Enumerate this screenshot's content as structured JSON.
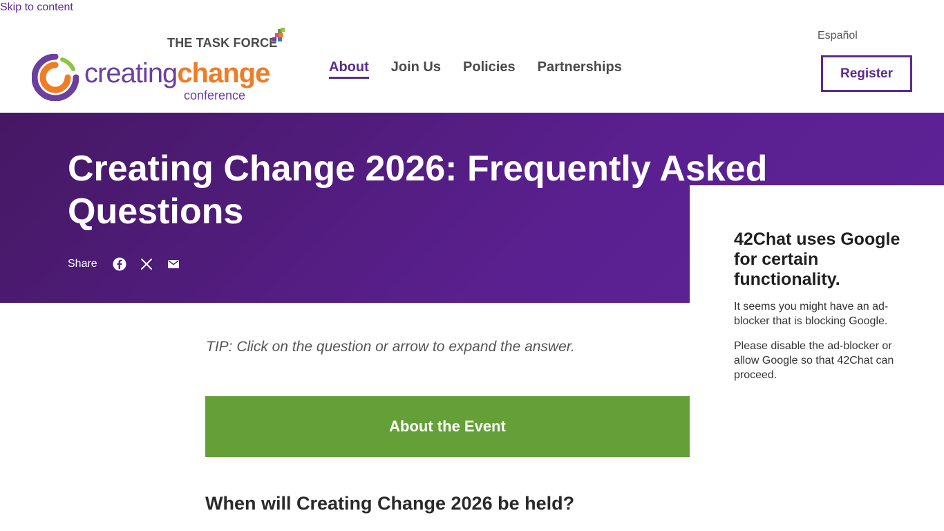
{
  "skip_link": "Skip to content",
  "logo": {
    "org": "THE TASK FORCE",
    "word_a": "creating",
    "word_b": "change",
    "sub": "conference"
  },
  "nav": {
    "items": [
      {
        "label": "About",
        "active": true
      },
      {
        "label": "Join Us",
        "active": false
      },
      {
        "label": "Policies",
        "active": false
      },
      {
        "label": "Partnerships",
        "active": false
      }
    ]
  },
  "header": {
    "language": "Español",
    "register": "Register"
  },
  "hero": {
    "title": "Creating Change 2026: Frequently Asked Questions",
    "share_label": "Share",
    "share_icons": [
      "facebook-icon",
      "x-icon",
      "email-icon"
    ]
  },
  "main": {
    "tip": "TIP: Click on the question or arrow to expand the answer.",
    "section_title": "About the Event",
    "question": "When will Creating Change 2026 be held?"
  },
  "chat": {
    "title": "42Chat uses Google for certain functionality.",
    "p1": "It seems you might have an ad-blocker that is blocking Google.",
    "p2": "Please disable the ad-blocker or allow Google so that 42Chat can proceed."
  },
  "colors": {
    "purple": "#5a2a91",
    "orange": "#f07c24",
    "green": "#64a037"
  }
}
